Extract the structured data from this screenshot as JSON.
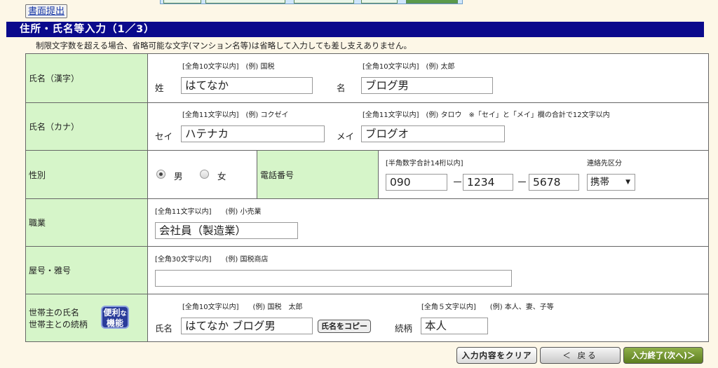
{
  "header": {
    "submit_link": "書面提出",
    "title": "住所・氏名等入力（1／3）",
    "notice": "制限文字数を超える場合、省略可能な文字(マンション名等)は省略して入力しても差し支えありません。"
  },
  "rows": {
    "name_kanji": {
      "label": "氏名（漢字）",
      "sei_hint": "[全角10文字以内]　(例) 国税",
      "mei_hint": "[全角10文字以内]　(例) 太郎",
      "sei_label": "姓",
      "mei_label": "名",
      "sei_value": "はてなか",
      "mei_value": "ブログ男"
    },
    "name_kana": {
      "label": "氏名（カナ）",
      "sei_hint": "[全角11文字以内]　(例) コクゼイ",
      "mei_hint": "[全角11文字以内]　(例) タロウ　※「セイ」と「メイ」欄の合計で12文字以内",
      "sei_label": "セイ",
      "mei_label": "メイ",
      "sei_value": "ハテナカ",
      "mei_value": "ブログオ"
    },
    "gender": {
      "label": "性別",
      "male": "男",
      "female": "女",
      "selected": "男"
    },
    "phone": {
      "label": "電話番号",
      "hint": "[半角数字合計14桁以内]",
      "part1": "090",
      "part2": "1234",
      "part3": "5678",
      "separator": "－",
      "contact_type_label": "連絡先区分",
      "contact_type_value": "携帯"
    },
    "occupation": {
      "label": "職業",
      "hint": "[全角11文字以内]　　(例) 小売業",
      "value": "会社員（製造業）"
    },
    "trade_name": {
      "label": "屋号・雅号",
      "hint": "[全角30文字以内]　　(例) 国税商店",
      "value": ""
    },
    "household": {
      "label_line1": "世帯主の氏名",
      "label_line2": "世帯主との続柄",
      "benri_line1": "便利",
      "benri_small": "な",
      "benri_line2": "機能",
      "name_hint": "[全角10文字以内]　　(例) 国税　太郎",
      "relation_hint": "[全角５文字以内]　　(例) 本人、妻、子等",
      "name_label": "氏名",
      "name_value": "はてなか ブログ男",
      "copy_button": "氏名をコピー",
      "relation_label": "続柄",
      "relation_value": "本人"
    }
  },
  "footer": {
    "clear": "入力内容をクリア",
    "back": "＜ 戻る",
    "next": "入力終了(次へ)＞"
  }
}
